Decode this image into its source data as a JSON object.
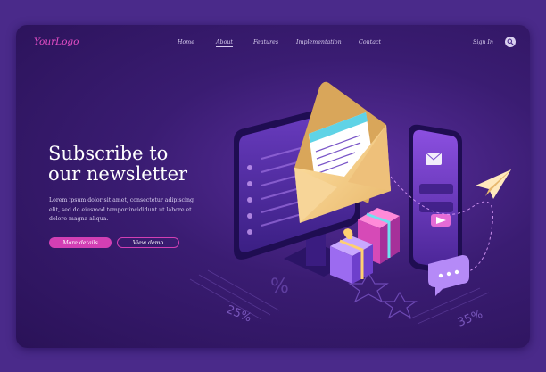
{
  "header": {
    "logo": "YourLogo",
    "nav": [
      {
        "label": "Home"
      },
      {
        "label": "About"
      },
      {
        "label": "Features"
      },
      {
        "label": "Implementation"
      },
      {
        "label": "Contact"
      }
    ],
    "active_nav": "About",
    "sign_in": "Sign In"
  },
  "hero": {
    "title_line1": "Subscribe to",
    "title_line2": "our newsletter",
    "description": "Lorem ipsum dolor sit amet, consectetur adipiscing elit, sed do eiusmod tempor incididunt ut labore et dolore magna aliqua.",
    "primary_button": "More details",
    "secondary_button": "View demo"
  },
  "illustration": {
    "discount_left": "25%",
    "discount_right": "35%",
    "percent_sign": "%"
  },
  "colors": {
    "background": "#4a2a8a",
    "accent": "#d23fb4",
    "logo": "#e84fc8",
    "envelope": "#f6cf8a",
    "nav_text": "#d7cdee"
  },
  "icons": [
    "search-icon",
    "envelope-icon",
    "paper-plane-icon",
    "gift-box-icon",
    "chat-bubble-icon",
    "phone-icon",
    "monitor-icon"
  ]
}
